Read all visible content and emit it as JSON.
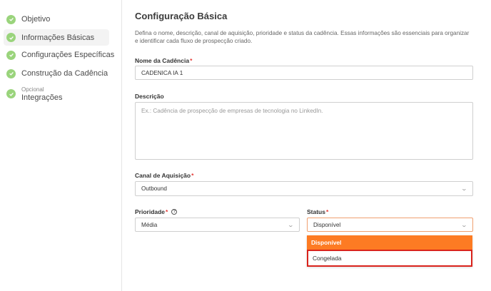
{
  "sidebar": {
    "steps": [
      {
        "label": "Objetivo"
      },
      {
        "label": "Informações Básicas"
      },
      {
        "label": "Configurações Específicas"
      },
      {
        "label": "Construção da Cadência"
      },
      {
        "small": "Opcional",
        "label": "Integrações"
      }
    ]
  },
  "main": {
    "title": "Configuração Básica",
    "description": "Defina o nome, descrição, canal de aquisição, prioridade e status da cadência. Essas informações são essenciais para organizar e identificar cada fluxo de prospecção criado.",
    "fields": {
      "name": {
        "label": "Nome da Cadência",
        "value": "CADENICA IA 1"
      },
      "description": {
        "label": "Descrição",
        "placeholder": "Ex.: Cadência de prospecção de empresas de tecnologia no LinkedIn."
      },
      "channel": {
        "label": "Canal de Aquisição",
        "value": "Outbound"
      },
      "priority": {
        "label": "Prioridade",
        "value": "Média"
      },
      "status": {
        "label": "Status",
        "value": "Disponível",
        "options": [
          "Disponível",
          "Congelada"
        ]
      }
    },
    "required_mark": "*"
  },
  "colors": {
    "accent": "#fd7b23",
    "check": "#9ad47c",
    "highlight": "#d9231c",
    "required": "#e53935"
  }
}
